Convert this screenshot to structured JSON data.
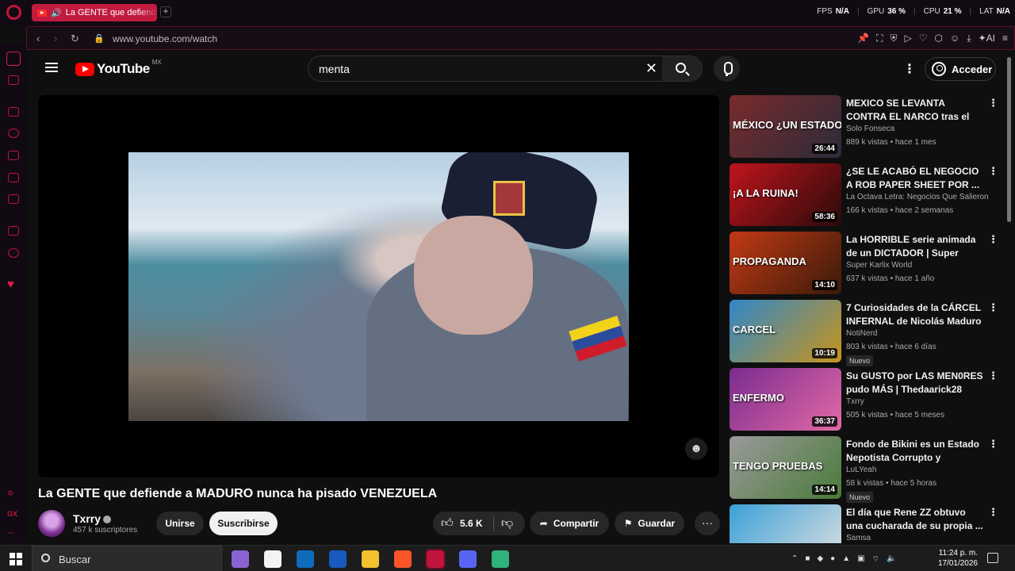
{
  "browser": {
    "tab_title": "La GENTE que defiende",
    "new_tab_label": "+",
    "hud": [
      {
        "label": "FPS",
        "value": "N/A"
      },
      {
        "label": "GPU",
        "value": "36 %"
      },
      {
        "label": "CPU",
        "value": "21 %"
      },
      {
        "label": "LAT",
        "value": "N/A"
      }
    ],
    "url": "www.youtube.com/watch"
  },
  "sidebar": {
    "gx_label": "GX"
  },
  "header": {
    "logo_text": "YouTube",
    "region": "MX",
    "search_value": "menta",
    "signin_label": "Acceder"
  },
  "video": {
    "title": "La GENTE que defiende a MADURO nunca ha pisado VENEZUELA",
    "channel": "Txrry",
    "subscribers": "457 k suscriptores",
    "join_label": "Unirse",
    "subscribe_label": "Suscribirse",
    "likes": "5.6 K",
    "share_label": "Compartir",
    "save_label": "Guardar"
  },
  "recommendations": [
    {
      "title": "MEXICO SE LEVANTA CONTRA EL NARCO tras el asesinato de...",
      "channel": "Solo Fonseca",
      "stats": "889 k vistas • hace 1 mes",
      "duration": "26:44",
      "thumb_text": "MÉXICO ¿UN ESTADO FALL",
      "badge": "",
      "thumb_colors": [
        "#7a2b2b",
        "#2b2b3a"
      ]
    },
    {
      "title": "¿SE LE ACABÓ EL NEGOCIO A ROB PAPER SHEET POR ...",
      "channel": "La Octava Letra: Negocios Que Salieron ...",
      "stats": "166 k vistas • hace 2 semanas",
      "duration": "58:36",
      "thumb_text": "¡A LA RUINA!",
      "badge": "",
      "thumb_colors": [
        "#c0151d",
        "#2a0a0a"
      ]
    },
    {
      "title": "La HORRIBLE serie animada de un DICTADOR | Super Bigote",
      "channel": "Super Karlix World",
      "stats": "637 k vistas • hace 1 año",
      "duration": "14:10",
      "thumb_text": "PROPAGANDA",
      "badge": "",
      "thumb_colors": [
        "#c23a14",
        "#3a1a0a"
      ]
    },
    {
      "title": "7 Curiosidades de la CÁRCEL INFERNAL de Nicolás Maduro",
      "channel": "NotiNerd",
      "stats": "803 k vistas • hace 6 días",
      "duration": "10:19",
      "thumb_text": "CARCEL",
      "badge": "Nuevo",
      "thumb_colors": [
        "#2f87c8",
        "#c9941c"
      ]
    },
    {
      "title": "Su GUSTO por LAS MEN0RES pudo MÁS | Thedaarick28",
      "channel": "Txrry",
      "stats": "505 k vistas • hace 5 meses",
      "duration": "36:37",
      "thumb_text": "ENFERMO",
      "badge": "",
      "thumb_colors": [
        "#7a2b8f",
        "#e26aa6"
      ]
    },
    {
      "title": "Fondo de Bikini es un Estado Nepotista Corrupto y Autoritario",
      "channel": "LuLYeah",
      "stats": "58 k vistas • hace 5 horas",
      "duration": "14:14",
      "thumb_text": "TENGO PRUEBAS",
      "badge": "Nuevo",
      "thumb_colors": [
        "#9a9a9a",
        "#4a7a3a"
      ]
    },
    {
      "title": "El día que Rene ZZ obtuvo una cucharada de su propia ...",
      "channel": "Samsa",
      "stats": "",
      "duration": "",
      "thumb_text": "",
      "badge": "",
      "thumb_colors": [
        "#3aa0d8",
        "#e0e0e0"
      ]
    }
  ],
  "taskbar": {
    "search_label": "Buscar",
    "time": "11:24 p. m.",
    "date": "17/01/2026",
    "apps": [
      {
        "name": "copilot",
        "color": "#8a63d2"
      },
      {
        "name": "store",
        "color": "#f3f3f3"
      },
      {
        "name": "outlook",
        "color": "#0f6cbd"
      },
      {
        "name": "word",
        "color": "#185abd"
      },
      {
        "name": "explorer",
        "color": "#f2c12e"
      },
      {
        "name": "brave",
        "color": "#fb542b"
      },
      {
        "name": "opera-gx",
        "color": "#c0143c"
      },
      {
        "name": "discord",
        "color": "#5865f2"
      },
      {
        "name": "app",
        "color": "#2fb37a"
      }
    ]
  }
}
